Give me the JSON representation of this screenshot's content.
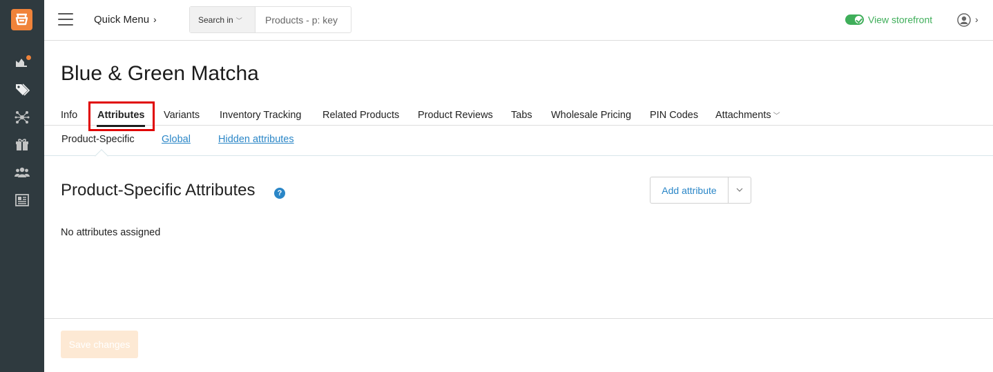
{
  "header": {
    "quick_menu_label": "Quick Menu",
    "search_in_label": "Search in",
    "search_placeholder": "Products - p: key",
    "view_storefront_label": "View storefront"
  },
  "sidebar": {
    "items": [
      {
        "icon": "dashboard-icon"
      },
      {
        "icon": "tags-icon"
      },
      {
        "icon": "network-icon"
      },
      {
        "icon": "gift-icon"
      },
      {
        "icon": "users-icon"
      },
      {
        "icon": "newspaper-icon"
      }
    ]
  },
  "page": {
    "title": "Blue & Green Matcha"
  },
  "tabs": [
    {
      "label": "Info"
    },
    {
      "label": "Attributes",
      "active": true
    },
    {
      "label": "Variants"
    },
    {
      "label": "Inventory Tracking"
    },
    {
      "label": "Related Products"
    },
    {
      "label": "Product Reviews"
    },
    {
      "label": "Tabs"
    },
    {
      "label": "Wholesale Pricing"
    },
    {
      "label": "PIN Codes"
    },
    {
      "label": "Attachments"
    }
  ],
  "subtabs": [
    {
      "label": "Product-Specific",
      "active": true
    },
    {
      "label": "Global"
    },
    {
      "label": "Hidden attributes"
    }
  ],
  "section": {
    "title": "Product-Specific Attributes",
    "help_symbol": "?",
    "add_attribute_label": "Add attribute",
    "empty_message": "No attributes assigned"
  },
  "footer": {
    "save_label": "Save changes"
  },
  "colors": {
    "sidebar_bg": "#2f3a3f",
    "brand_orange": "#f0833a",
    "link_blue": "#2a86c7",
    "storefront_green": "#3fae5a",
    "highlight_red": "#e00000"
  }
}
